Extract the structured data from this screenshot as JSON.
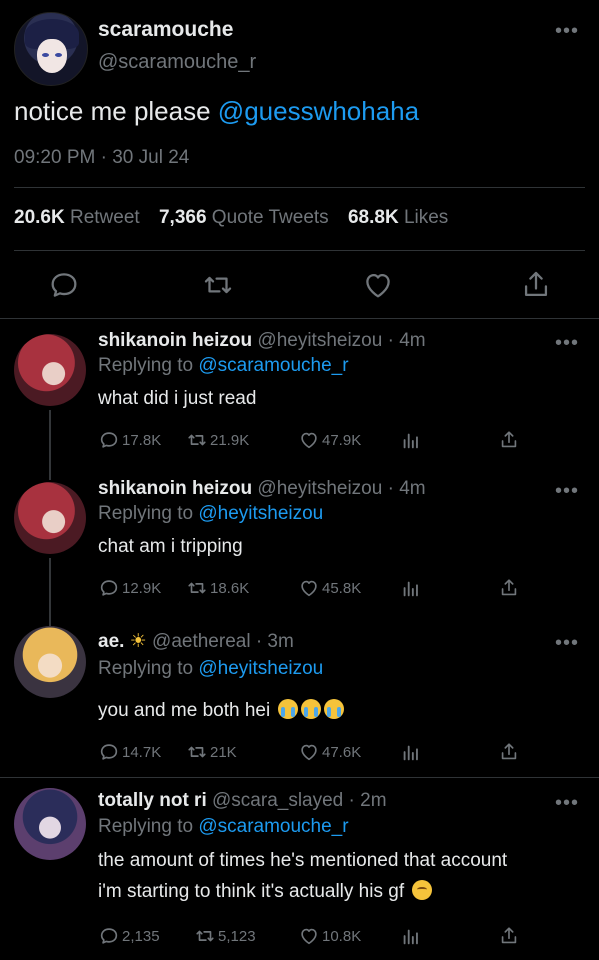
{
  "main_tweet": {
    "name": "scaramouche",
    "handle": "@scaramouche_r",
    "text_plain": "notice me please ",
    "text_mention": "@guesswhohaha",
    "timestamp": "09:20 PM · 30 Jul 24",
    "stats": {
      "retweets_count": "20.6K",
      "retweets_label": "Retweet",
      "quotes_count": "7,366",
      "quotes_label": "Quote Tweets",
      "likes_count": "68.8K",
      "likes_label": "Likes"
    },
    "actions": {
      "reply_icon": "reply-icon",
      "retweet_icon": "retweet-icon",
      "like_icon": "heart-icon",
      "share_icon": "share-icon"
    },
    "more_label": "•••"
  },
  "replies": [
    {
      "name": "shikanoin heizou",
      "handle_time": "@heyitsheizou · 4m",
      "replying_prefix": "Replying to ",
      "replying_to": "@scaramouche_r",
      "text": "what did i just read",
      "replies": "17.8K",
      "retweets": "21.9K",
      "likes": "47.9K",
      "more_label": "•••"
    },
    {
      "name": "shikanoin heizou",
      "handle_time": "@heyitsheizou · 4m",
      "replying_prefix": "Replying to ",
      "replying_to": "@heyitsheizou",
      "text": "chat am i tripping",
      "replies": "12.9K",
      "retweets": "18.6K",
      "likes": "45.8K",
      "more_label": "•••"
    },
    {
      "name": "ae.",
      "handle_time": "@aethereal · 3m",
      "replying_prefix": "Replying to ",
      "replying_to": "@heyitsheizou",
      "text": "you and me both hei",
      "replies": "14.7K",
      "retweets": "21K",
      "likes": "47.6K",
      "more_label": "•••"
    },
    {
      "name": "totally not ri",
      "handle_time": "@scara_slayed · 2m",
      "replying_prefix": "Replying to ",
      "replying_to": "@scaramouche_r",
      "text_line1": "the amount of times he's mentioned that account",
      "text_line2": "i'm starting to think it's actually his gf",
      "replies": "2,135",
      "retweets": "5,123",
      "likes": "10.8K",
      "more_label": "•••"
    }
  ],
  "colors": {
    "background": "#000000",
    "text": "#e7e9ea",
    "secondary": "#71767b",
    "accent": "#1d9bf0",
    "divider": "#2f3336"
  }
}
